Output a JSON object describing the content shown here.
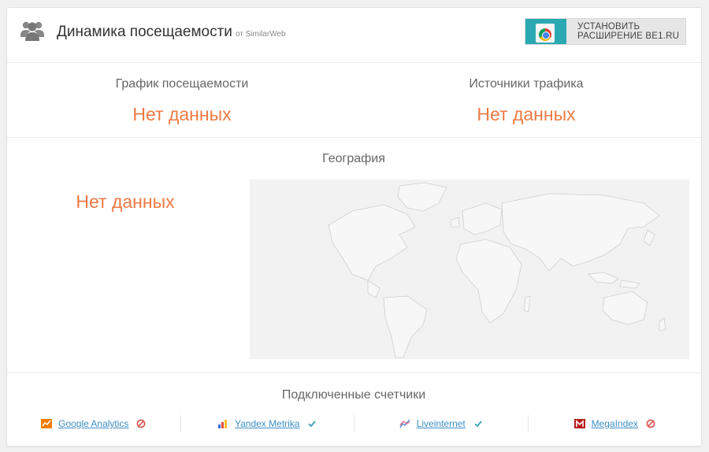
{
  "header": {
    "title": "Динамика посещаемости",
    "source": "от SimilarWeb",
    "extension_line1": "УСТАНОВИТЬ",
    "extension_line2": "РАСШИРЕНИЕ BE1.RU"
  },
  "traffic": {
    "title": "График посещаемости",
    "no_data": "Нет данных"
  },
  "sources": {
    "title": "Источники трафика",
    "no_data": "Нет данных"
  },
  "geo": {
    "title": "География",
    "no_data": "Нет данных"
  },
  "counters": {
    "title": "Подключенные счетчики",
    "items": [
      {
        "label": "Google Analytics",
        "icon": "google-analytics-icon",
        "status": "not-connected"
      },
      {
        "label": "Yandex Metrika",
        "icon": "yandex-metrika-icon",
        "status": "connected"
      },
      {
        "label": "Liveinternet",
        "icon": "liveinternet-icon",
        "status": "connected"
      },
      {
        "label": "MegaIndex",
        "icon": "megaindex-icon",
        "status": "not-connected"
      }
    ]
  },
  "colors": {
    "accent_orange": "#ee7a44",
    "link_blue": "#3c8fc6",
    "check_teal": "#3fa7b8",
    "forbidden_red": "#d9534f"
  }
}
